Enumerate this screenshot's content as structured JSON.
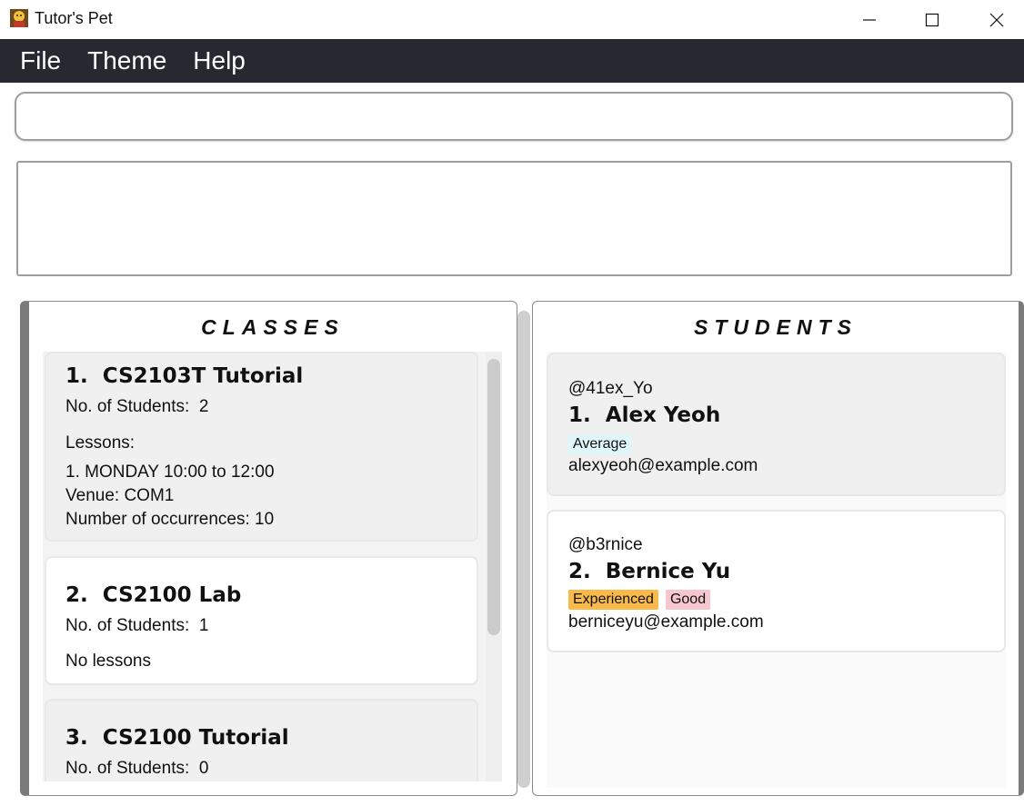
{
  "window": {
    "title": "Tutor's Pet",
    "icon": "tutor-pet-app-icon",
    "controls": {
      "minimize": "minimize-icon",
      "maximize": "maximize-icon",
      "close": "close-icon"
    }
  },
  "menu": {
    "items": [
      {
        "label": "File"
      },
      {
        "label": "Theme"
      },
      {
        "label": "Help"
      }
    ]
  },
  "command": {
    "value": "",
    "placeholder": ""
  },
  "result": {
    "text": ""
  },
  "classes": {
    "title": "CLASSES",
    "items": [
      {
        "index": "1.",
        "name": "CS2103T Tutorial",
        "students_label": "No. of Students:",
        "students_count": "2",
        "lessons_label": "Lessons:",
        "lesson_line": "1. MONDAY 10:00 to 12:00",
        "venue_line": "Venue: COM1",
        "occurrences_line": "Number of occurrences: 10"
      },
      {
        "index": "2.",
        "name": "CS2100 Lab",
        "students_label": "No. of Students:",
        "students_count": "1",
        "no_lessons": "No lessons"
      },
      {
        "index": "3.",
        "name": "CS2100 Tutorial",
        "students_label": "No. of Students:",
        "students_count": "0"
      }
    ]
  },
  "students": {
    "title": "STUDENTS",
    "items": [
      {
        "handle": "@41ex_Yo",
        "index": "1.",
        "name": "Alex Yeoh",
        "tags": [
          {
            "label": "Average",
            "color": "#e0f7fa"
          }
        ],
        "email": "alexyeoh@example.com"
      },
      {
        "handle": "@b3rnice",
        "index": "2.",
        "name": "Bernice Yu",
        "tags": [
          {
            "label": "Experienced",
            "color": "#f9b94b"
          },
          {
            "label": "Good",
            "color": "#f7c6cf"
          }
        ],
        "email": "berniceyu@example.com"
      }
    ]
  },
  "colors": {
    "menubar_bg": "#262a30",
    "card_grey": "#f0f0f0",
    "panel_border": "#7a7a7a"
  }
}
